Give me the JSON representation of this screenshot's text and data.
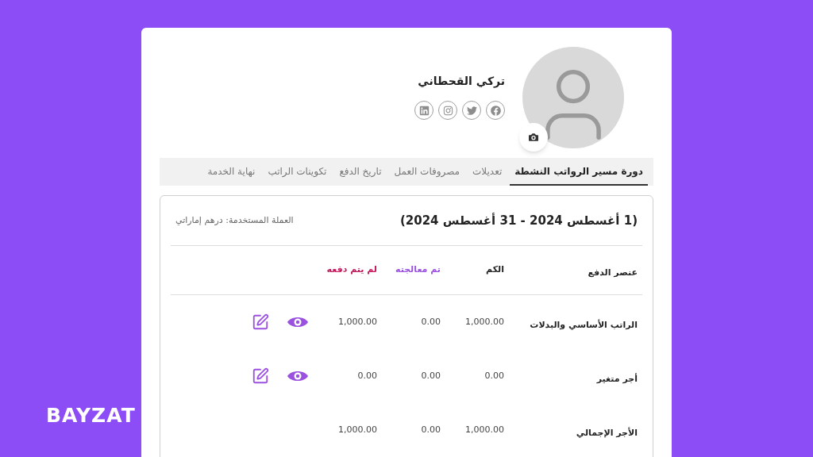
{
  "brand": "BAYZAT",
  "profile": {
    "name": "تركي القحطاني"
  },
  "tabs": [
    {
      "label": "دورة مسير الرواتب النشطة",
      "selected": true
    },
    {
      "label": "تعديلات",
      "selected": false
    },
    {
      "label": "مصروفات العمل",
      "selected": false
    },
    {
      "label": "تاريخ الدفع",
      "selected": false
    },
    {
      "label": "تكوينات الراتب",
      "selected": false
    },
    {
      "label": "نهاية الخدمة",
      "selected": false
    }
  ],
  "period": {
    "title": "(1 أغسطس 2024 - 31 أغسطس 2024)",
    "currency": "العملة المستخدمة: درهم إماراتي"
  },
  "table": {
    "columns": [
      {
        "label": "عنصر الدفع",
        "color": "#222222"
      },
      {
        "label": "الكم",
        "color": "#222222"
      },
      {
        "label": "تم معالجته",
        "color": "#9b51e0"
      },
      {
        "label": "لم يتم دفعه",
        "color": "#c2185b"
      }
    ],
    "rows": [
      {
        "item": "الراتب الأساسي والبدلات",
        "amount": "1,000.00",
        "processed": "0.00",
        "unpaid": "1,000.00",
        "actions": true
      },
      {
        "item": "أجر متغير",
        "amount": "0.00",
        "processed": "0.00",
        "unpaid": "0.00",
        "actions": true
      },
      {
        "item": "الأجر الإجمالي",
        "amount": "1,000.00",
        "processed": "0.00",
        "unpaid": "1,000.00",
        "actions": false
      }
    ]
  }
}
